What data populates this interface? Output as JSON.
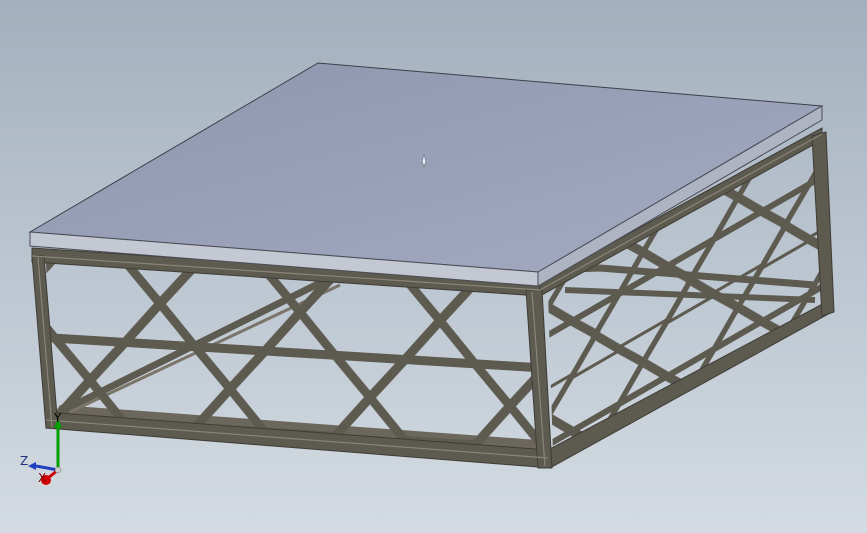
{
  "viewport": {
    "background_top": "#a3b0bd",
    "background_bottom": "#d4dbe2",
    "model": {
      "top_plate_color": "#9aa1b9",
      "plate_edge_color": "#c3c8d3",
      "frame_color": "#5d5a50",
      "frame_highlight": "#8a8577",
      "origin_marker_icon": "diamond-marker-icon"
    }
  },
  "triad": {
    "x_label": "X",
    "y_label": "Y",
    "z_label": "Z",
    "x_color": "#d00000",
    "y_color": "#00a000",
    "z_color": "#2040c0"
  }
}
